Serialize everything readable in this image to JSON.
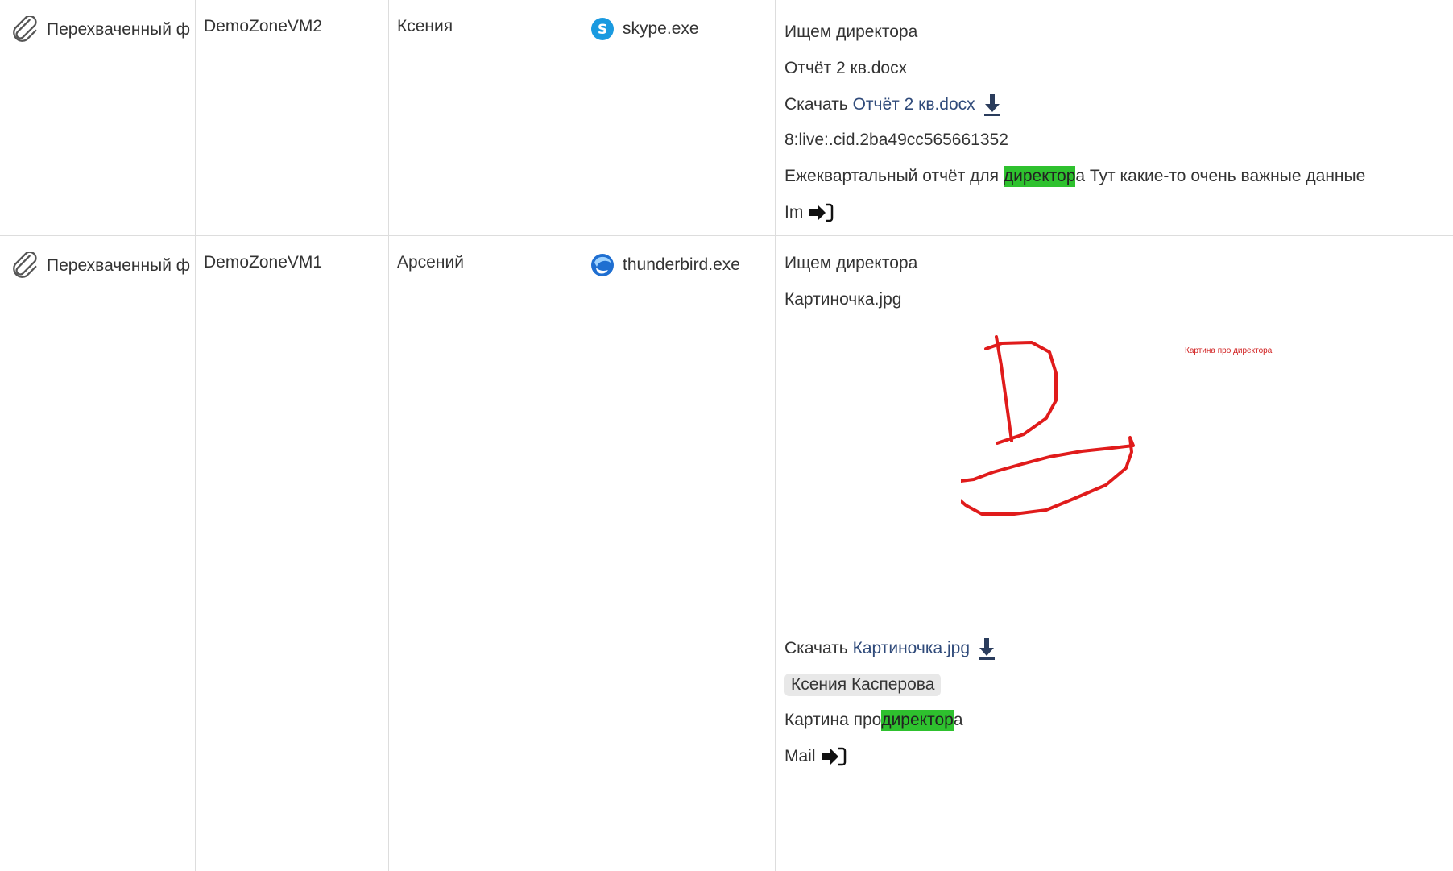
{
  "rows": [
    {
      "type": "Перехваченный ф",
      "computer": "DemoZoneVM2",
      "user": "Ксения",
      "app": {
        "name": "skype.exe",
        "icon": "skype-icon"
      },
      "content": {
        "query": "Ищем директора",
        "filename": "Отчёт 2 кв.docx",
        "download_label": "Скачать",
        "download_link": "Отчёт 2 кв.docx",
        "id_line": "8:live:.cid.2ba49cc565661352",
        "body_before": "Ежеквартальный отчёт для ",
        "body_highlight": "директор",
        "body_after": "а Тут какие-то очень важные данные",
        "channel": "Im"
      }
    },
    {
      "type": "Перехваченный ф",
      "computer": "DemoZoneVM1",
      "user": "Арсений",
      "app": {
        "name": "thunderbird.exe",
        "icon": "thunderbird-icon"
      },
      "content": {
        "query": "Ищем директора",
        "filename": "Картиночка.jpg",
        "image_caption": "Картина про директора",
        "download_label": "Скачать",
        "download_link": "Картиночка.jpg",
        "sender_tag": "Ксения Касперова",
        "body_before": "Картина про",
        "body_highlight": "директор",
        "body_after": "а",
        "channel": "Mail"
      }
    }
  ],
  "colors": {
    "highlight": "#2ec12e",
    "link": "#2f4a7a",
    "drawing": "#e01b1b",
    "border": "#dddddd"
  }
}
